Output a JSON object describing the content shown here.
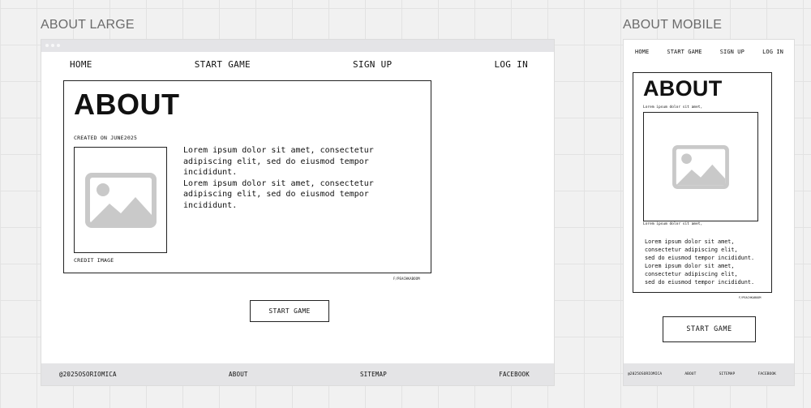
{
  "frames": {
    "large_label": "ABOUT LARGE",
    "mobile_label": "ABOUT MOBILE"
  },
  "large": {
    "nav": [
      "HOME",
      "START GAME",
      "SIGN UP",
      "LOG IN"
    ],
    "title": "ABOUT",
    "created": "CREATED ON JUNE2025",
    "image_icon": "image-placeholder-icon",
    "credit": "CREDIT IMAGE",
    "body": [
      "Lorem ipsum dolor sit amet, consectetur\nadipiscing elit, sed do eiusmod tempor\nincididunt.",
      "Lorem ipsum dolor sit amet, consectetur\nadipiscing elit, sed do eiusmod tempor\nincididunt."
    ],
    "handle": "F/PEACHKABOOM",
    "start_button": "START GAME",
    "footer": {
      "copyright": "@2025OSORIOMICA",
      "about": "ABOUT",
      "sitemap": "SITEMAP",
      "facebook": "FACEBOOK"
    }
  },
  "mobile": {
    "nav": [
      "HOME",
      "START GAME",
      "SIGN UP",
      "LOG IN"
    ],
    "title": "ABOUT",
    "caption_top": "Lorem ipsum dolor sit amet,",
    "image_icon": "image-placeholder-icon",
    "caption_bottom": "Lorem ipsum dolor sit amet,",
    "body": [
      "Lorem ipsum dolor sit amet,\nconsectetur adipiscing elit,\nsed do eiusmod tempor incididunt.",
      "Lorem ipsum dolor sit amet,\nconsectetur adipiscing elit,\nsed do eiusmod tempor incididunt."
    ],
    "handle": "F/PEACHKABOOM",
    "start_button": "START GAME",
    "footer": {
      "copyright": "@2025OSORIOMICA",
      "about": "ABOUT",
      "sitemap": "SITEMAP",
      "facebook": "FACEBOOK"
    }
  },
  "colors": {
    "canvas": "#f1f1f1",
    "grid": "#e2e2e2",
    "frame_bar": "#e4e4e7",
    "placeholder": "#c9c9c9"
  }
}
